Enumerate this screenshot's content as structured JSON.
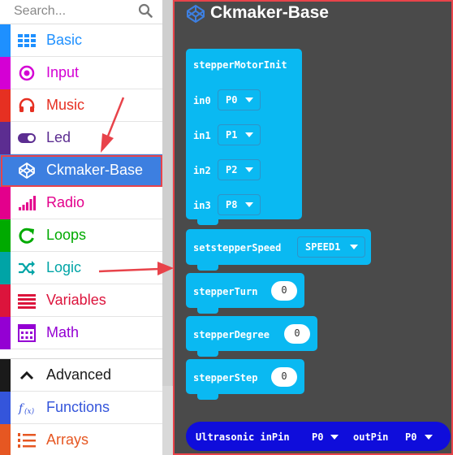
{
  "search": {
    "placeholder": "Search..."
  },
  "categories": [
    {
      "label": "Basic",
      "color": "#1e90ff",
      "icon": "grid-icon"
    },
    {
      "label": "Input",
      "color": "#d400d4",
      "icon": "target-icon"
    },
    {
      "label": "Music",
      "color": "#e63022",
      "icon": "headphones-icon"
    },
    {
      "label": "Led",
      "color": "#5c2d91",
      "icon": "toggle-icon"
    },
    {
      "label": "Ckmaker-Base",
      "color": "#3d7fe0",
      "icon": "codepen-icon",
      "selected": true
    },
    {
      "label": "Radio",
      "color": "#e3008c",
      "icon": "signal-bars-icon"
    },
    {
      "label": "Loops",
      "color": "#00aa00",
      "icon": "refresh-icon"
    },
    {
      "label": "Logic",
      "color": "#00a4a6",
      "icon": "shuffle-icon"
    },
    {
      "label": "Variables",
      "color": "#dc143c",
      "icon": "list-lines-icon"
    },
    {
      "label": "Math",
      "color": "#9400d3",
      "icon": "calculator-icon"
    }
  ],
  "advanced": [
    {
      "label": "Advanced",
      "color": "#1a1a1a",
      "icon": "chevron-up-icon"
    },
    {
      "label": "Functions",
      "color": "#3455db",
      "icon": "function-icon"
    },
    {
      "label": "Arrays",
      "color": "#e65722",
      "icon": "numbered-list-icon"
    }
  ],
  "flyout": {
    "title": "Ckmaker-Base",
    "blocks": {
      "stepper_init": {
        "label": "stepperMotorInit",
        "rows": [
          {
            "label": "in0",
            "value": "P0"
          },
          {
            "label": "in1",
            "value": "P1"
          },
          {
            "label": "in2",
            "value": "P2"
          },
          {
            "label": "in3",
            "value": "P8"
          }
        ]
      },
      "set_speed": {
        "label": "setstepperSpeed",
        "value": "SPEED1"
      },
      "turn": {
        "label": "stepperTurn",
        "value": "0"
      },
      "degree": {
        "label": "stepperDegree",
        "value": "0"
      },
      "step": {
        "label": "stepperStep",
        "value": "0"
      },
      "ultrasonic": {
        "label": "Ultrasonic inPin",
        "in_value": "P0",
        "out_label": "outPin",
        "out_value": "P0"
      }
    }
  },
  "colors": {
    "block": "#0ab9f2",
    "flyout_bg": "#4a4a4a",
    "highlight": "#e8434a",
    "ultrasonic": "#0f0ddb"
  }
}
